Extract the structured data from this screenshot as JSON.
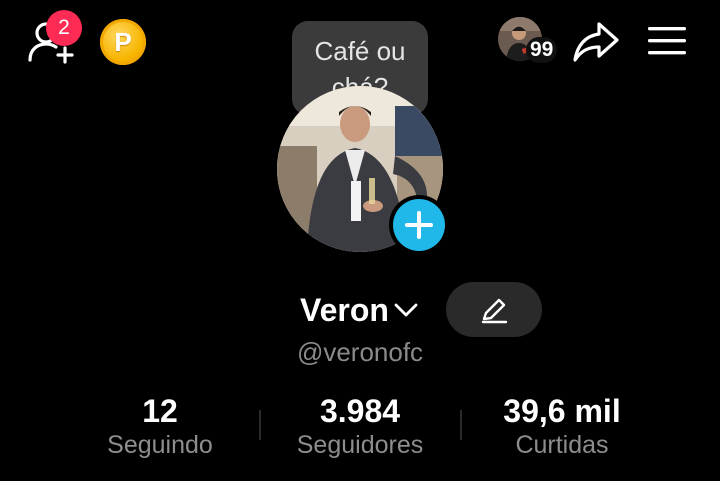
{
  "topbar": {
    "friend_requests_badge": "2",
    "coin_letter": "P",
    "friends_count": "99",
    "icons": {
      "add_friend": "add-user-icon",
      "coin": "coin-icon",
      "share": "share-icon",
      "menu": "hamburger-menu-icon"
    }
  },
  "tooltip": {
    "line1": "Café ou",
    "line2": "chá?"
  },
  "profile": {
    "name": "Veron",
    "handle": "@veronofc"
  },
  "stats": [
    {
      "value": "12",
      "label": "Seguindo"
    },
    {
      "value": "3.984",
      "label": "Seguidores"
    },
    {
      "value": "39,6 mil",
      "label": "Curtidas"
    }
  ],
  "colors": {
    "background": "#000000",
    "badge": "#fe2c55",
    "accent_blue": "#20b7e9",
    "coin": "#f7b500"
  }
}
